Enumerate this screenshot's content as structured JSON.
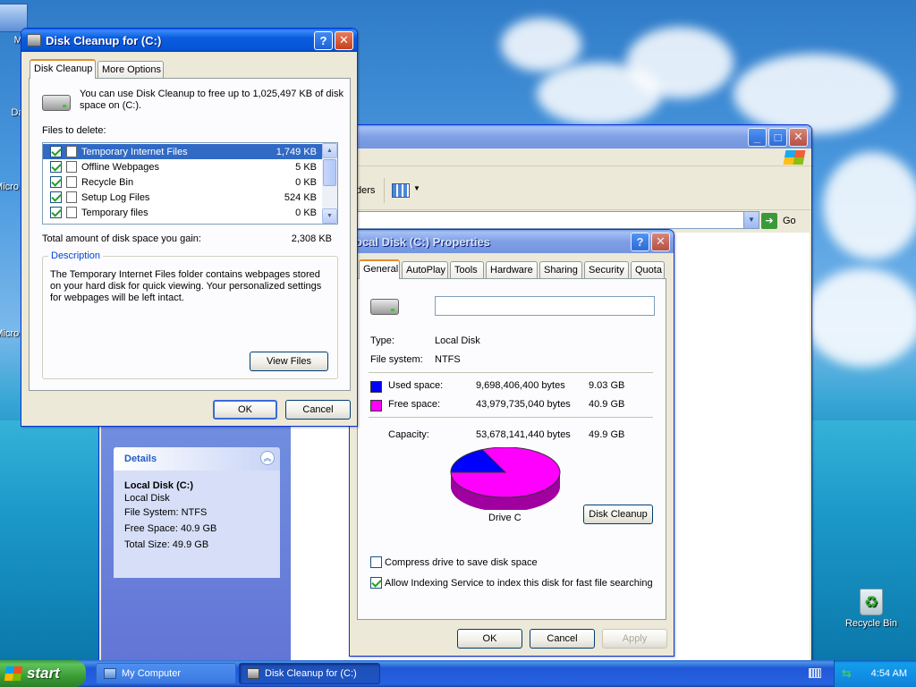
{
  "desktop": {
    "icons": [
      {
        "label": "My"
      },
      {
        "label": "Dat"
      },
      {
        "label": "Micro C"
      },
      {
        "label": "Micro B"
      },
      {
        "label": "Recycle Bin"
      }
    ]
  },
  "my_computer": {
    "go_label": "Go",
    "toolbar_fragment": "ders",
    "details": {
      "header": "Details",
      "name": "Local Disk (C:)",
      "type": "Local Disk",
      "file_system": "File System: NTFS",
      "free_space": "Free Space: 40.9 GB",
      "total_size": "Total Size: 49.9 GB"
    }
  },
  "properties": {
    "title": "ocal Disk (C:) Properties",
    "tabs": [
      "General",
      "AutoPlay",
      "Tools",
      "Hardware",
      "Sharing",
      "Security",
      "Quota"
    ],
    "label_value": "",
    "type_label": "Type:",
    "type_value": "Local Disk",
    "fs_label": "File system:",
    "fs_value": "NTFS",
    "used": {
      "label": "Used space:",
      "bytes": "9,698,406,400 bytes",
      "size": "9.03 GB",
      "color": "#0000ff"
    },
    "free": {
      "label": "Free space:",
      "bytes": "43,979,735,040 bytes",
      "size": "40.9 GB",
      "color": "#ff00ff"
    },
    "capacity": {
      "label": "Capacity:",
      "bytes": "53,678,141,440 bytes",
      "size": "49.9 GB"
    },
    "drive_label": "Drive C",
    "disk_cleanup_button": "Disk Cleanup",
    "compress_label": "Compress drive to save disk space",
    "compress_checked": false,
    "index_label": "Allow Indexing Service to index this disk for fast file searching",
    "index_checked": true,
    "ok": "OK",
    "cancel": "Cancel",
    "apply": "Apply"
  },
  "cleanup": {
    "title": "Disk Cleanup for  (C:)",
    "tabs": [
      "Disk Cleanup",
      "More Options"
    ],
    "intro": "You can use Disk Cleanup to free up to 1,025,497 KB of disk space on  (C:).",
    "files_to_delete_label": "Files to delete:",
    "files": [
      {
        "name": "Temporary Internet Files",
        "size": "1,749 KB",
        "checked": true
      },
      {
        "name": "Offline Webpages",
        "size": "5 KB",
        "checked": true
      },
      {
        "name": "Recycle Bin",
        "size": "0 KB",
        "checked": true
      },
      {
        "name": "Setup Log Files",
        "size": "524 KB",
        "checked": true
      },
      {
        "name": "Temporary files",
        "size": "0 KB",
        "checked": true
      }
    ],
    "total_label": "Total amount of disk space you gain:",
    "total_value": "2,308 KB",
    "description_legend": "Description",
    "description_text": "The Temporary Internet Files folder contains webpages stored on your hard disk for quick viewing. Your personalized settings for webpages will be left intact.",
    "view_files": "View Files",
    "ok": "OK",
    "cancel": "Cancel"
  },
  "taskbar": {
    "start": "start",
    "items": [
      "My Computer",
      "Disk Cleanup for  (C:)"
    ],
    "clock": "4:54 AM"
  }
}
